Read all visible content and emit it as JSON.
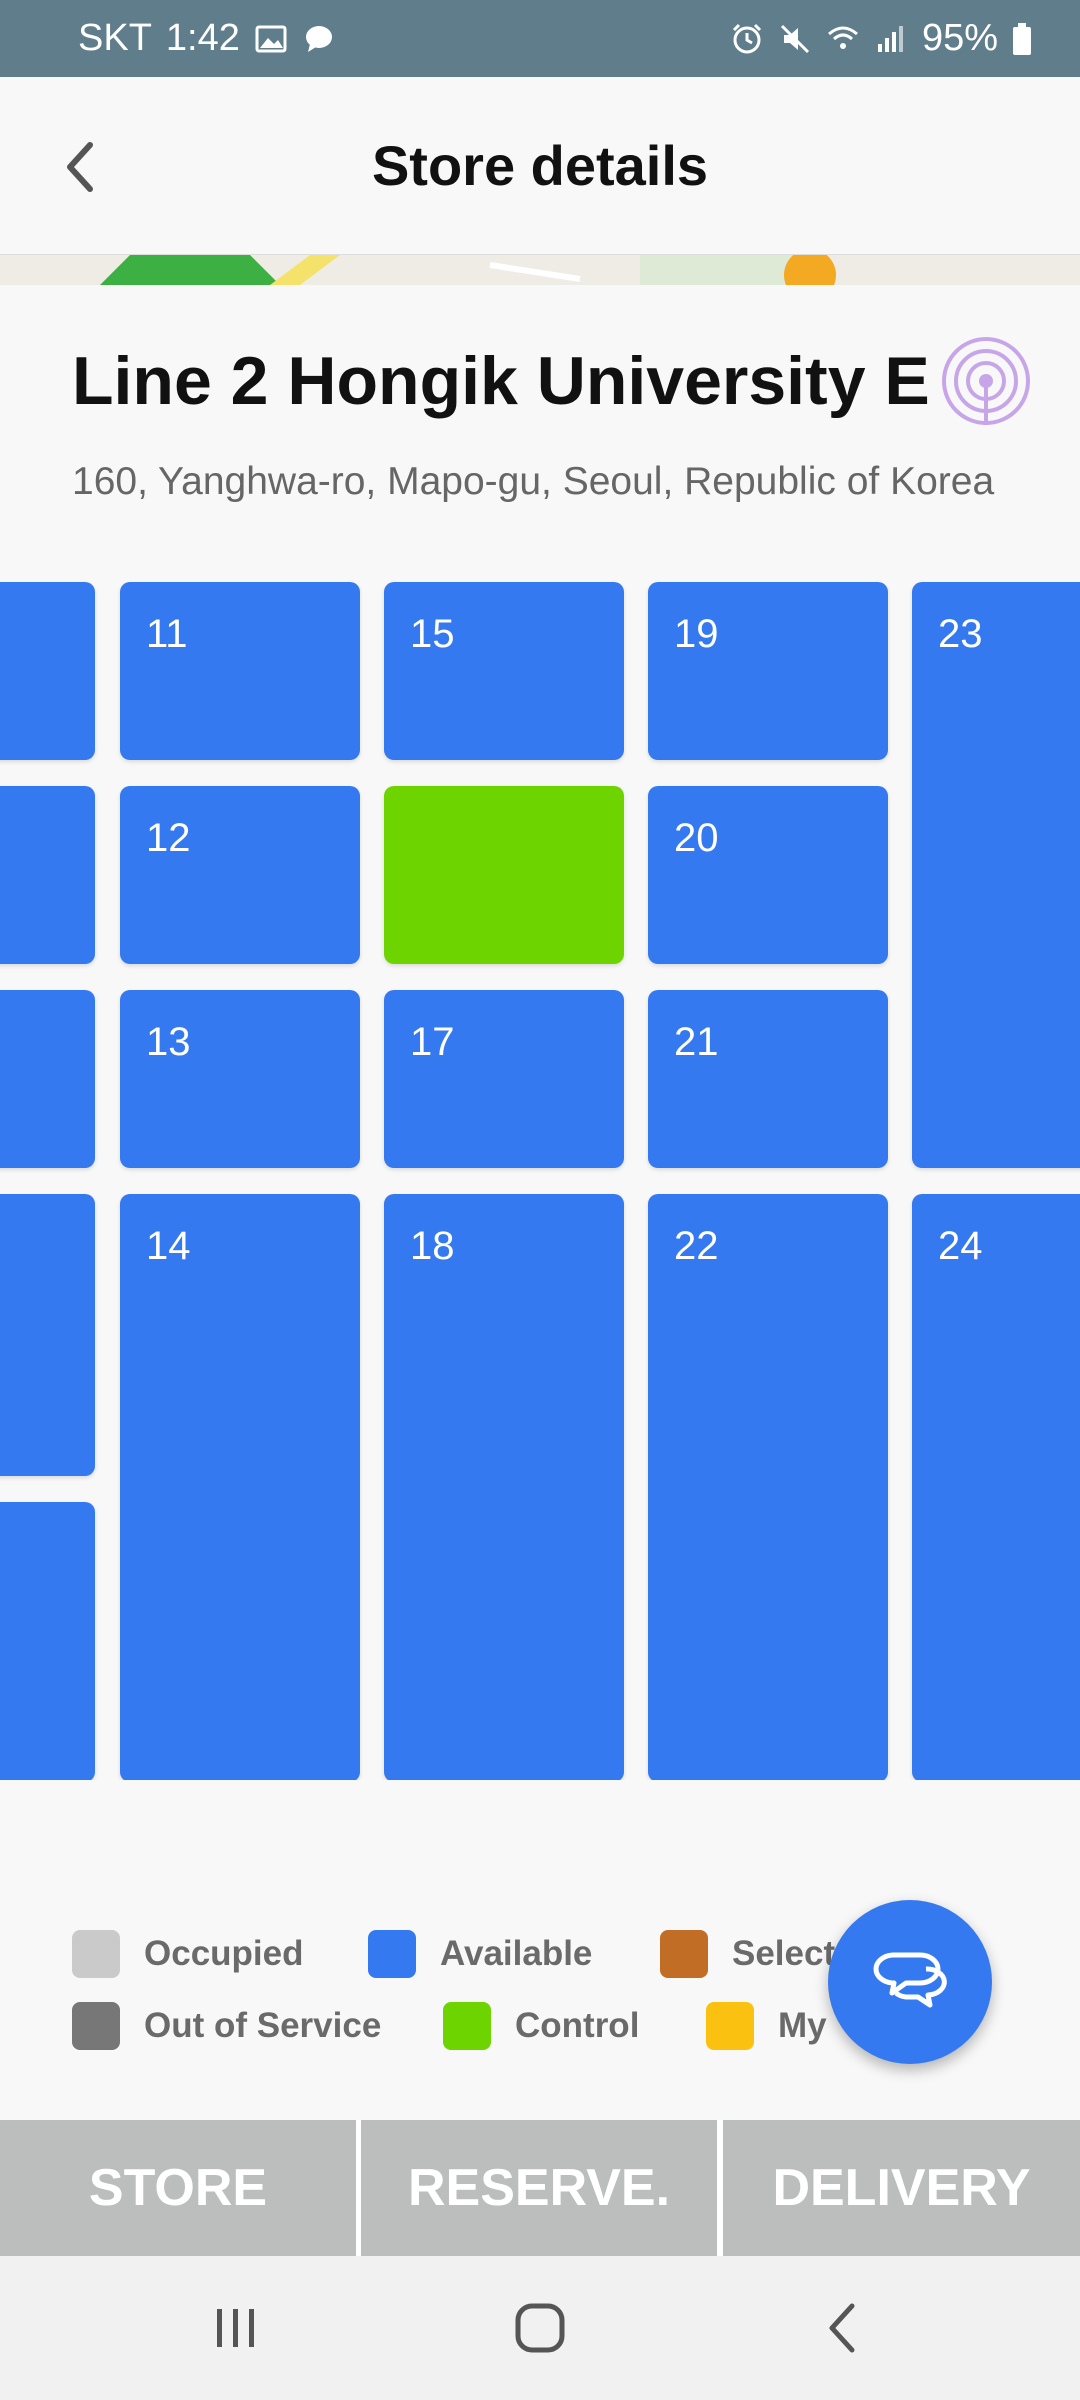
{
  "status_bar": {
    "carrier": "SKT",
    "time": "1:42",
    "battery": "95%"
  },
  "header": {
    "title": "Store details"
  },
  "store": {
    "name": "Line 2 Hongik University E",
    "address": "160, Yanghwa-ro, Mapo-gu, Seoul, Republic of Korea"
  },
  "lockers": [
    {
      "label": "",
      "status": "available"
    },
    {
      "label": "",
      "status": "available"
    },
    {
      "label": "",
      "status": "available"
    },
    {
      "label": "",
      "status": "available"
    },
    {
      "label": "",
      "status": "available"
    },
    {
      "label": "11",
      "status": "available"
    },
    {
      "label": "12",
      "status": "available"
    },
    {
      "label": "13",
      "status": "available"
    },
    {
      "label": "14",
      "status": "available"
    },
    {
      "label": "15",
      "status": "available"
    },
    {
      "label": "",
      "status": "control"
    },
    {
      "label": "17",
      "status": "available"
    },
    {
      "label": "18",
      "status": "available"
    },
    {
      "label": "19",
      "status": "available"
    },
    {
      "label": "20",
      "status": "available"
    },
    {
      "label": "21",
      "status": "available"
    },
    {
      "label": "22",
      "status": "available"
    },
    {
      "label": "23",
      "status": "available"
    },
    {
      "label": "24",
      "status": "available"
    }
  ],
  "legend": [
    {
      "label": "Occupied",
      "color": "#cacaca"
    },
    {
      "label": "Available",
      "color": "#3579f1"
    },
    {
      "label": "Select",
      "color": "#c26d25"
    },
    {
      "label": "Out of Service",
      "color": "#777777"
    },
    {
      "label": "Control",
      "color": "#6ed400"
    },
    {
      "label": "My",
      "color": "#fbc110"
    }
  ],
  "tabs": [
    {
      "label": "STORE"
    },
    {
      "label": "RESERVE."
    },
    {
      "label": "DELIVERY"
    }
  ],
  "colors": {
    "available": "#3579f1",
    "control": "#6ed400",
    "status_bar": "#5f7d8b",
    "tab_bg": "#bcbebd"
  },
  "icons": {
    "back": "chevron-left-icon",
    "beacon": "beacon-signal-icon",
    "chat": "chat-bubbles-icon"
  }
}
